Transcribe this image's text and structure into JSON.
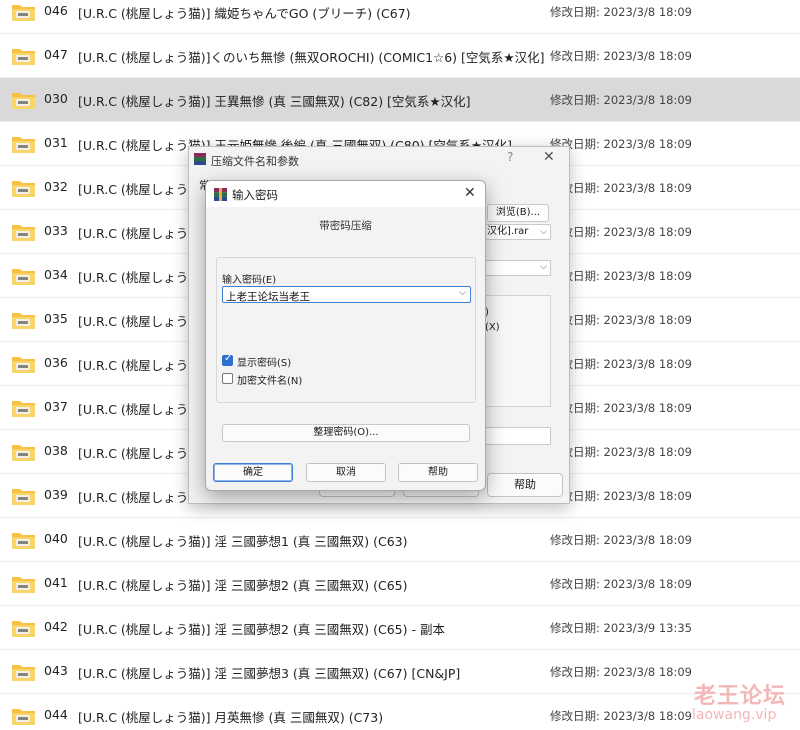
{
  "files": [
    {
      "num": "046",
      "name": "[U.R.C (桃屋しょう猫)] 織姫ちゃんでGO (ブリーチ) (C67)",
      "date": "修改日期: 2023/3/8 18:09",
      "selected": false
    },
    {
      "num": "047",
      "name": "[U.R.C (桃屋しょう猫)]くのいち無慘 (無双OROCHI) (COMIC1☆6) [空気系★汉化]",
      "date": "修改日期: 2023/3/8 18:09",
      "selected": false
    },
    {
      "num": "030",
      "name": "[U.R.C (桃屋しょう猫)] 王異無慘 (真 三國無双) (C82) [空気系★汉化]",
      "date": "修改日期: 2023/3/8 18:09",
      "selected": true
    },
    {
      "num": "031",
      "name": "[U.R.C (桃屋しょう猫)] 王元姫無慘 後編 (真 三國無双) (C80) [空気系★汉化]",
      "date": "修改日期: 2023/3/8 18:09",
      "selected": false
    },
    {
      "num": "032",
      "name": "[U.R.C (桃屋しょう猫",
      "date": "修改日期: 2023/3/8 18:09",
      "selected": false
    },
    {
      "num": "033",
      "name": "[U.R.C (桃屋しょう猫",
      "date": "修改日期: 2023/3/8 18:09",
      "selected": false
    },
    {
      "num": "034",
      "name": "[U.R.C (桃屋しょう猫",
      "date": "修改日期: 2023/3/8 18:09",
      "selected": false
    },
    {
      "num": "035",
      "name": "[U.R.C (桃屋しょう猫",
      "date": "修改日期: 2023/3/8 18:09",
      "selected": false
    },
    {
      "num": "036",
      "name": "[U.R.C (桃屋しょう猫",
      "date": "修改日期: 2023/3/8 18:09",
      "selected": false
    },
    {
      "num": "037",
      "name": "[U.R.C (桃屋しょう猫",
      "date": "修改日期: 2023/3/8 18:09",
      "selected": false
    },
    {
      "num": "038",
      "name": "[U.R.C (桃屋しょう猫",
      "date": "修改日期: 2023/3/8 18:09",
      "selected": false
    },
    {
      "num": "039",
      "name": "[U.R.C (桃屋しょう猫",
      "date": "修改日期: 2023/3/8 18:09",
      "selected": false
    },
    {
      "num": "040",
      "name": "[U.R.C (桃屋しょう猫)] 淫 三國夢想1 (真 三國無双) (C63)",
      "date": "修改日期: 2023/3/8 18:09",
      "selected": false
    },
    {
      "num": "041",
      "name": "[U.R.C (桃屋しょう猫)] 淫 三國夢想2 (真 三國無双) (C65)",
      "date": "修改日期: 2023/3/8 18:09",
      "selected": false
    },
    {
      "num": "042",
      "name": "[U.R.C (桃屋しょう猫)] 淫 三國夢想2 (真 三國無双) (C65) - 副本",
      "date": "修改日期: 2023/3/9 13:35",
      "selected": false
    },
    {
      "num": "043",
      "name": "[U.R.C (桃屋しょう猫)] 淫 三國夢想3 (真 三國無双) (C67) [CN&JP]",
      "date": "修改日期: 2023/3/8 18:09",
      "selected": false
    },
    {
      "num": "044",
      "name": "[U.R.C (桃屋しょう猫)] 月英無慘 (真 三國無双) (C73)",
      "date": "修改日期: 2023/3/8 18:09",
      "selected": false
    }
  ],
  "outer_dialog": {
    "title": "压缩文件名和参数",
    "help_icon": "?",
    "close_icon": "✕",
    "tab_fragment": "常",
    "browse_label": "浏览(B)...",
    "archive_name_fragment": "★汉化].rar",
    "option_fragment_1": ")",
    "option_fragment_2": "(X)",
    "help_button": "帮助"
  },
  "password_dialog": {
    "title": "输入密码",
    "close_icon": "✕",
    "heading": "带密码压缩",
    "password_label": "输入密码(E)",
    "password_value": "上老王论坛当老王",
    "show_password_label": "显示密码(S)",
    "show_password_checked": true,
    "encrypt_names_label": "加密文件名(N)",
    "encrypt_names_checked": false,
    "organize_button": "整理密码(O)...",
    "ok_button": "确定",
    "cancel_button": "取消",
    "help_button": "帮助"
  },
  "watermark": {
    "main": "老王论坛",
    "sub": "laowang.vip"
  },
  "colors": {
    "selection": "#d9d9d9",
    "accent": "#2f6fcf",
    "folder": "#f5c242"
  }
}
